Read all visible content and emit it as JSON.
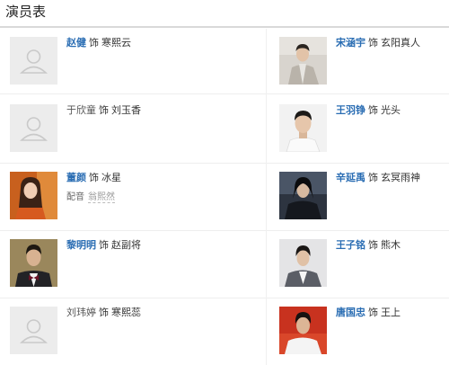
{
  "page": {
    "title": "演员表"
  },
  "cast": [
    {
      "actor": "赵健",
      "sep": "饰",
      "role": "寒熙云",
      "photo": "placeholder-avatar",
      "linked": true
    },
    {
      "actor": "宋涵宇",
      "sep": "饰",
      "role": "玄阳真人",
      "photo": "photo-light-grey-suit",
      "linked": true
    },
    {
      "actor": "于欣童",
      "sep": "饰",
      "role": "刘玉香",
      "photo": "placeholder-avatar",
      "linked": false
    },
    {
      "actor": "王羽铮",
      "sep": "饰",
      "role": "光头",
      "photo": "photo-white-shirt",
      "linked": true
    },
    {
      "actor": "董颜",
      "sep": "饰",
      "role": "冰星",
      "photo": "photo-orange-dress",
      "linked": true,
      "dub_label": "配音",
      "dub_name": "翁熙然"
    },
    {
      "actor": "辛延禹",
      "sep": "饰",
      "role": "玄冥雨神",
      "photo": "photo-dark-costume",
      "linked": true
    },
    {
      "actor": "黎明明",
      "sep": "饰",
      "role": "赵副将",
      "photo": "photo-bow-tie",
      "linked": true
    },
    {
      "actor": "王子铭",
      "sep": "饰",
      "role": "熊木",
      "photo": "photo-grey-suit",
      "linked": true
    },
    {
      "actor": "刘玮婷",
      "sep": "饰",
      "role": "寒熙蕊",
      "photo": "placeholder-avatar",
      "linked": false
    },
    {
      "actor": "唐国忠",
      "sep": "饰",
      "role": "王上",
      "photo": "photo-red-background",
      "linked": true
    }
  ]
}
